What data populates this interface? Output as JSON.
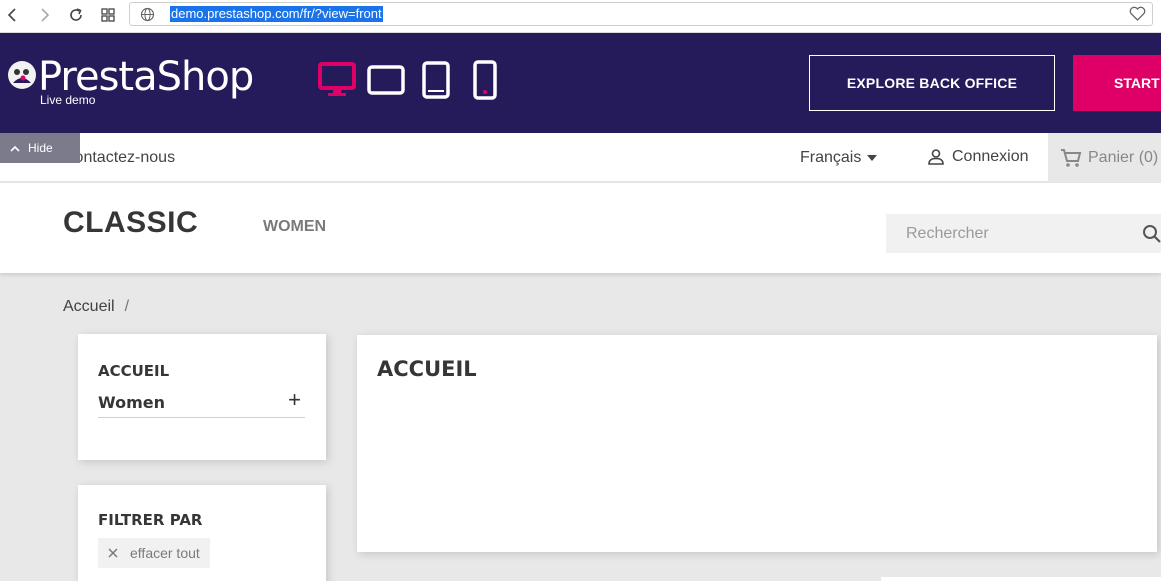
{
  "browser": {
    "url": "demo.prestashop.com/fr/?view=front"
  },
  "demo_banner": {
    "logo_text": "PrestaShop",
    "logo_subtext": "Live demo",
    "explore_button": "EXPLORE BACK OFFICE",
    "start_button": "START",
    "accent_color": "#df0067",
    "bg_color": "#251b5b"
  },
  "hide_tab": {
    "label": "Hide"
  },
  "topnav": {
    "contact": "Contactez-nous",
    "language": "Français",
    "login": "Connexion",
    "cart": "Panier (0)"
  },
  "header": {
    "brand": "CLASSIC",
    "menu_women": "WOMEN",
    "search_placeholder": "Rechercher"
  },
  "breadcrumb": {
    "home": "Accueil",
    "separator": "/"
  },
  "sidebar": {
    "categories_title": "ACCUEIL",
    "category_women": "Women",
    "filter_title": "FILTRER PAR",
    "clear_all": "effacer tout"
  },
  "main": {
    "title": "ACCUEIL"
  }
}
